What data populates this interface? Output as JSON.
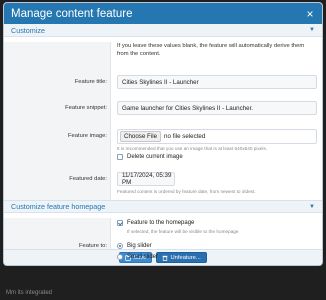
{
  "dialog": {
    "title": "Manage content feature",
    "close_icon": "close-icon"
  },
  "sections": {
    "customize": "Customize",
    "customize_homepage": "Customize feature homepage"
  },
  "intro": "If you leave these values blank, the feature will automatically derive them from the content.",
  "fields": {
    "title": {
      "label": "Feature title:",
      "value": "Cities Skylines II - Launcher"
    },
    "snippet": {
      "label": "Feature snippet:",
      "value": "Game launcher for Cities Skylines II - Launcher."
    },
    "image": {
      "label": "Feature image:",
      "button": "Choose File",
      "status": "no file selected",
      "hint": "It is recommended that you use an image that is at least 640x640 pixels.",
      "delete_label": "Delete current image",
      "delete_checked": false
    },
    "date": {
      "label": "Featured date:",
      "value": "11/17/2024, 05:39 PM",
      "hint": "Featured content is ordered by feature date, from newest to oldest."
    }
  },
  "homepage": {
    "label": "Feature to:",
    "checkbox_label": "Feature to the homepage",
    "checkbox_hint": "If selected, the feature will be visible to the homepage",
    "checkbox_checked": true,
    "options": [
      {
        "label": "Big slider",
        "checked": true
      },
      {
        "label": "Small slider",
        "checked": false
      }
    ]
  },
  "buttons": {
    "save": "Save",
    "unfeature": "Unfeature..."
  },
  "background": {
    "hint_text": "Mm its integrated"
  },
  "colors": {
    "header": "#2577b1",
    "accent": "#2577b1",
    "save_button": "#3c8ad0"
  }
}
